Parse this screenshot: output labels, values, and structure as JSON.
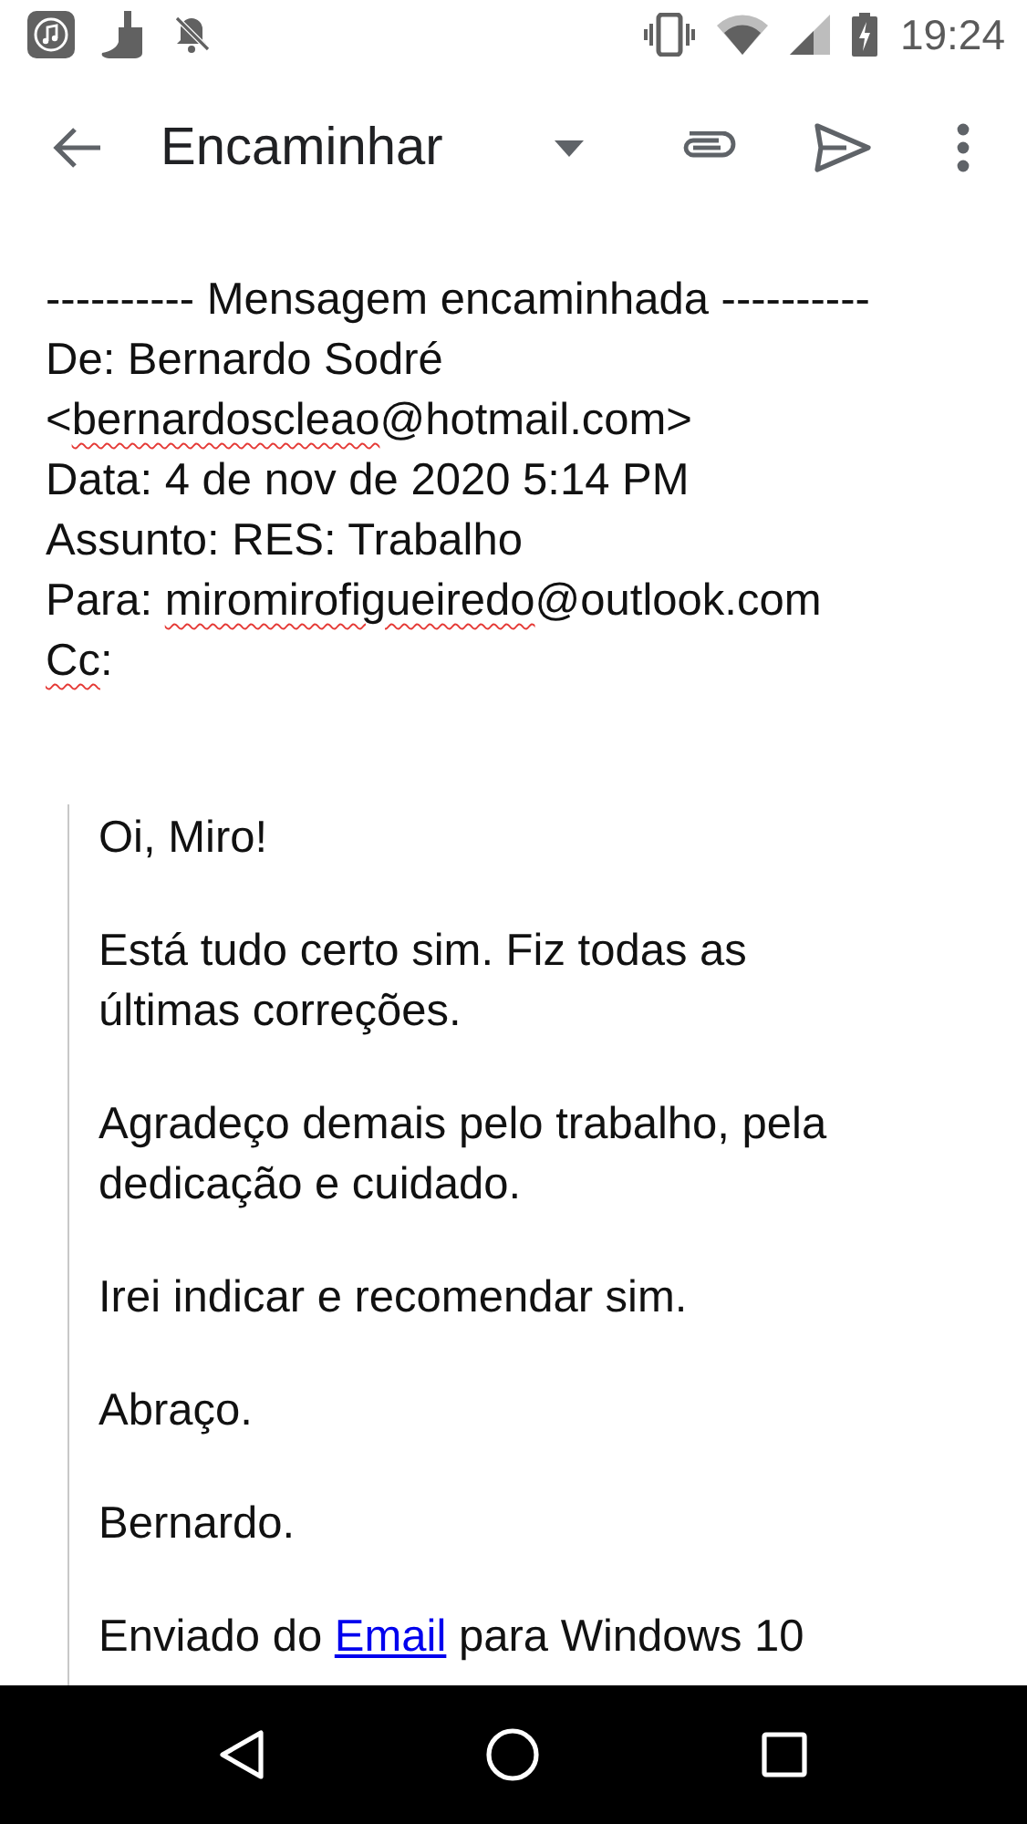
{
  "status_bar": {
    "time": "19:24"
  },
  "toolbar": {
    "title": "Encaminhar"
  },
  "forwarded_header": [
    {
      "segments": [
        {
          "text": "---------- Mensagem encaminhada ----------",
          "misspelled": false
        }
      ]
    },
    {
      "segments": [
        {
          "text": "De: Bernardo Sodré",
          "misspelled": false
        }
      ]
    },
    {
      "segments": [
        {
          "text": "<",
          "misspelled": false
        },
        {
          "text": "bernardoscleao",
          "misspelled": true
        },
        {
          "text": "@hotmail.com>",
          "misspelled": false
        }
      ]
    },
    {
      "segments": [
        {
          "text": "Data: 4 de nov de 2020 5:14 PM",
          "misspelled": false
        }
      ]
    },
    {
      "segments": [
        {
          "text": "Assunto: RES: Trabalho",
          "misspelled": false
        }
      ]
    },
    {
      "segments": [
        {
          "text": "Para: ",
          "misspelled": false
        },
        {
          "text": "miromirofigueiredo",
          "misspelled": true
        },
        {
          "text": "@outlook.com",
          "misspelled": false
        }
      ]
    },
    {
      "segments": [
        {
          "text": "Cc",
          "misspelled": true
        },
        {
          "text": ":",
          "misspelled": false
        }
      ]
    }
  ],
  "quoted_message": [
    {
      "kind": "text",
      "text": "Oi, Miro!"
    },
    {
      "kind": "text",
      "text": "Está tudo certo sim. Fiz todas as últimas correções."
    },
    {
      "kind": "text",
      "text": "Agradeço demais pelo trabalho, pela dedicação e cuidado."
    },
    {
      "kind": "text",
      "text": "Irei indicar e recomendar sim."
    },
    {
      "kind": "text",
      "text": "Abraço."
    },
    {
      "kind": "text",
      "text": "Bernardo."
    },
    {
      "kind": "link_line",
      "before": "Enviado do ",
      "link": "Email",
      "after": " para Windows 10"
    }
  ]
}
